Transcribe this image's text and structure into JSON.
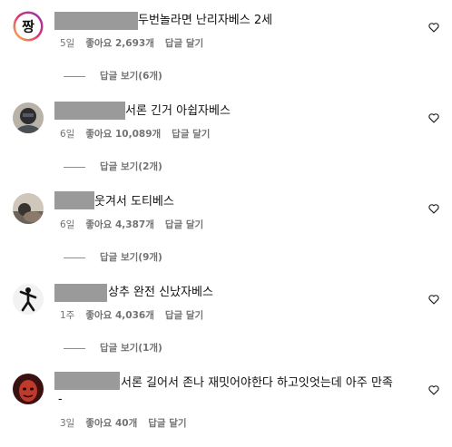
{
  "comments": [
    {
      "avatar": "jjang-badge-avatar",
      "text": "두번놀라면 난리자베스 2세",
      "time": "5일",
      "likes": "좋아요 2,693개",
      "reply": "답글 달기",
      "view_replies": "답글 보기(6개)"
    },
    {
      "avatar": "person-photo-avatar",
      "text": "서론 긴거 아쉽자베스",
      "time": "6일",
      "likes": "좋아요 10,089개",
      "reply": "답글 달기",
      "view_replies": "답글 보기(2개)"
    },
    {
      "avatar": "person-photo-avatar",
      "text": "웃겨서 도티베스",
      "time": "6일",
      "likes": "좋아요 4,387개",
      "reply": "답글 달기",
      "view_replies": "답글 보기(9개)"
    },
    {
      "avatar": "dancer-silhouette-avatar",
      "text": "상추 완전 신났자베스",
      "time": "1주",
      "likes": "좋아요 4,036개",
      "reply": "답글 달기",
      "view_replies": "답글 보기(1개)"
    },
    {
      "avatar": "red-face-avatar",
      "text": "서론 길어서 존나 재밋어야한다 하고잇엇는데 아주 만족",
      "text_line2": "-",
      "time": "3일",
      "likes": "좋아요 40개",
      "reply": "답글 달기"
    }
  ],
  "badge_text": "짱",
  "icons": {
    "like": "heart-icon"
  },
  "colors": {
    "meta": "#737373",
    "mask": "#9a9a9a",
    "badge_ring": "#c13584"
  }
}
